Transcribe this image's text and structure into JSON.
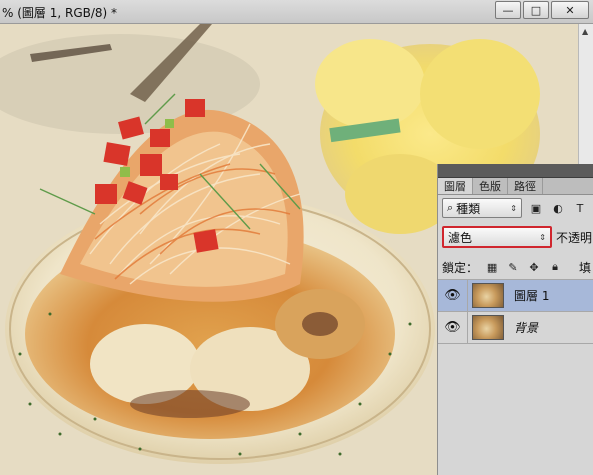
{
  "window": {
    "title": "% (圖層 1, RGB/8) *",
    "minimize": "—",
    "restore": "□",
    "close": "✕"
  },
  "panel": {
    "tabs": [
      {
        "label": "圖層",
        "active": true
      },
      {
        "label": "色版",
        "active": false
      },
      {
        "label": "路徑",
        "active": false
      }
    ],
    "filter": {
      "label": "種類",
      "icon": "search-icon"
    },
    "filter_icons": [
      "image-icon",
      "circle-half-icon",
      "text-icon"
    ],
    "blend_mode": "濾色",
    "opacity_label": "不透明",
    "lock_label": "鎖定：",
    "lock_icons": [
      "lock-transparent-icon",
      "brush-icon",
      "move-icon",
      "lock-icon"
    ],
    "fill_label": "填",
    "layers": [
      {
        "name": "圖層 1",
        "visible": true,
        "selected": true
      },
      {
        "name": "背景",
        "visible": true,
        "selected": false,
        "italic": true
      }
    ]
  },
  "colors": {
    "selection_highlight": "#a7b8d9",
    "blend_outline": "#d0262e",
    "panel_bg": "#d6d6d6"
  }
}
